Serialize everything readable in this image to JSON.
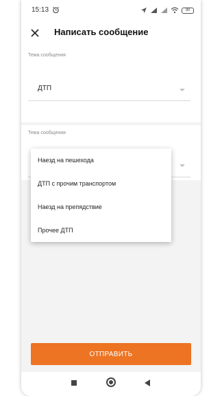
{
  "status_bar": {
    "time": "15:13",
    "battery": "30"
  },
  "header": {
    "title": "Написать сообщение"
  },
  "form": {
    "field1": {
      "label": "Тема сообщения",
      "value": "ДТП"
    },
    "field2": {
      "label": "Тема сообщения"
    }
  },
  "popup": {
    "items": [
      "Наезд на пешехода",
      "ДТП с прочим транспортом",
      "Наезд на препядствие",
      "Прочее ДТП"
    ]
  },
  "send_button": {
    "label": "ОТПРАВИТЬ"
  },
  "colors": {
    "accent": "#ec7423",
    "background": "#f3f3f3"
  },
  "icons": {
    "close": "close-icon",
    "alarm": "alarm-icon",
    "location": "location-arrow-icon",
    "signal": "signal-icon",
    "wifi": "wifi-icon",
    "battery": "battery-icon",
    "back": "nav-back-icon",
    "home": "nav-home-icon",
    "recent": "nav-recent-icon"
  }
}
